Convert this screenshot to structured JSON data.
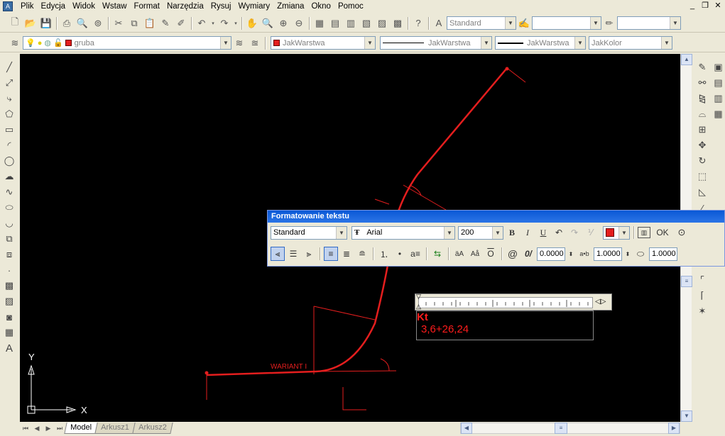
{
  "menu": {
    "items": [
      "Plik",
      "Edycja",
      "Widok",
      "Wstaw",
      "Format",
      "Narzędzia",
      "Rysuj",
      "Wymiary",
      "Zmiana",
      "Okno",
      "Pomoc"
    ],
    "window_controls": [
      "_",
      "❐",
      "✕"
    ]
  },
  "toolbar": {
    "text_style": "Standard"
  },
  "layers": {
    "current_layer": "gruba",
    "color": "JakWarstwa",
    "linetype": "JakWarstwa",
    "lineweight": "JakWarstwa",
    "plotstyle": "JakKolor"
  },
  "drawing": {
    "label_variant": "WARIANT I",
    "axis_x": "X",
    "axis_y": "Y",
    "line_color": "#e41e1e"
  },
  "text_format_dialog": {
    "title": "Formatowanie tekstu",
    "style": "Standard",
    "font": "Arial",
    "height": "200",
    "ok_label": "OK",
    "oblique": "0.0000",
    "tracking": "1.0000",
    "width_factor": "1.0000",
    "bold_label": "B",
    "italic_label": "I",
    "underline_label": "U"
  },
  "text_editor": {
    "line1": "Kt",
    "line2": "3,6+26,24"
  },
  "tabs": [
    "Model",
    "Arkusz1",
    "Arkusz2"
  ]
}
